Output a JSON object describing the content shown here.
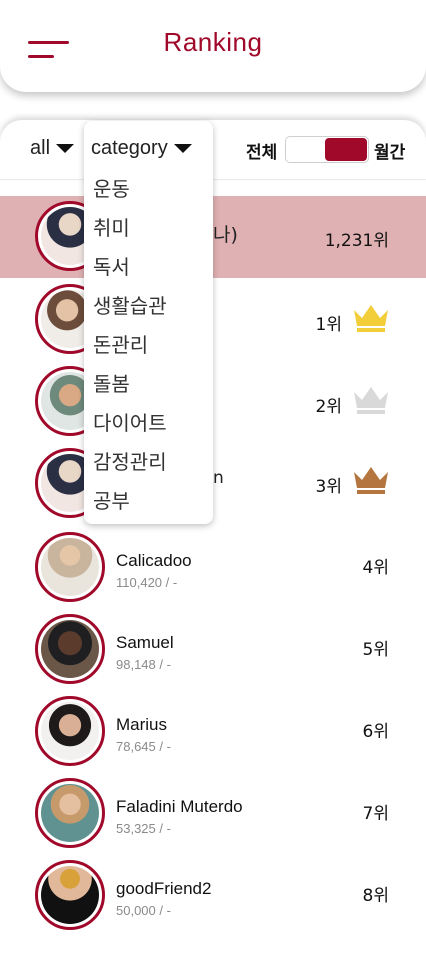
{
  "header": {
    "title": "Ranking"
  },
  "filters": {
    "period_label": "all",
    "category_label": "category",
    "segment_all": "전체",
    "segment_monthly": "월간"
  },
  "category_menu": [
    "운동",
    "취미",
    "독서",
    "생활습관",
    "돈관리",
    "돌봄",
    "다이어트",
    "감정관리",
    "공부"
  ],
  "my_row": {
    "name_fragment": "나)",
    "count": "1,231위"
  },
  "podium": [
    {
      "rank": "1위",
      "crown": "gold-crown-icon",
      "color": "#f2ce3a"
    },
    {
      "rank": "2위",
      "crown": "silver-crown-icon",
      "color": "#d9d9d9"
    },
    {
      "rank": "3위",
      "crown": "bronze-crown-icon",
      "color": "#b4753f",
      "name_fragment": "n"
    }
  ],
  "ranking": [
    {
      "name": "Calicadoo",
      "score": "110,420 / -",
      "rank": "4위"
    },
    {
      "name": "Samuel",
      "score": "98,148 / -",
      "rank": "5위"
    },
    {
      "name": "Marius",
      "score": "78,645 / -",
      "rank": "6위"
    },
    {
      "name": "Faladini Muterdo",
      "score": "53,325 / -",
      "rank": "7위"
    },
    {
      "name": "goodFriend2",
      "score": "50,000 / -",
      "rank": "8위"
    }
  ],
  "colors": {
    "accent": "#a0092a",
    "highlight_row": "#e0b1b3"
  }
}
